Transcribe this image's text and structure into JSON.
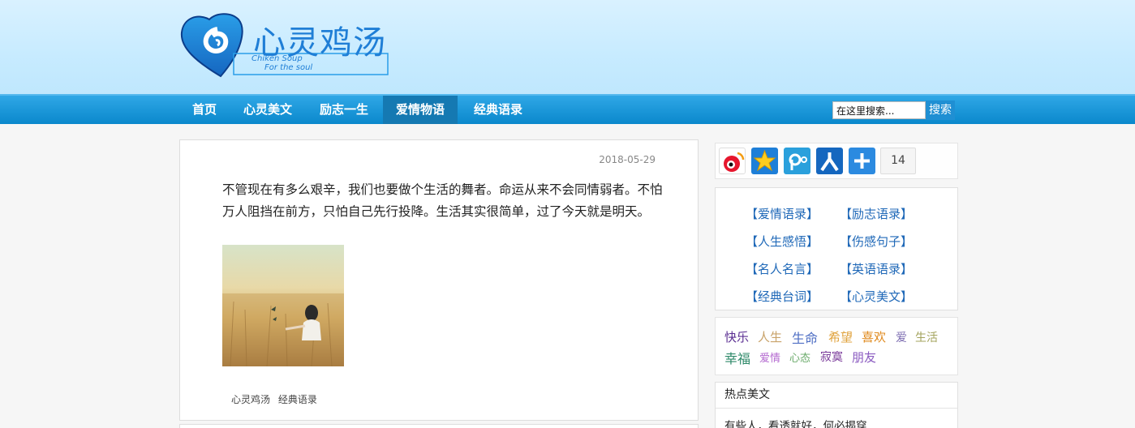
{
  "site": {
    "logo_title": "心灵鸡汤",
    "logo_subtitle_1": "Chiken Soup",
    "logo_subtitle_2": "For the soul"
  },
  "nav": {
    "items": [
      {
        "label": "首页"
      },
      {
        "label": "心灵美文"
      },
      {
        "label": "励志一生"
      },
      {
        "label": "爱情物语"
      },
      {
        "label": "经典语录"
      }
    ],
    "active": "爱情物语"
  },
  "search": {
    "value": "在这里搜索...",
    "button_label": "搜索"
  },
  "post": {
    "date": "2018-05-29",
    "text": "不管现在有多么艰辛，我们也要做个生活的舞者。命运从来不会同情弱者。不怕万人阻挡在前方，只怕自己先行投降。生活其实很简单，过了今天就是明天。",
    "tags": [
      "心灵鸡汤",
      "经典语录"
    ]
  },
  "share": {
    "icons": [
      "weibo-icon",
      "qzone-icon",
      "tencent-weibo-icon",
      "renren-icon",
      "more-share-icon"
    ],
    "count": "14"
  },
  "categories": [
    "【爱情语录】",
    "【励志语录】",
    "【人生感悟】",
    "【伤感句子】",
    "【名人名言】",
    "【英语语录】",
    "【经典台词】",
    "【心灵美文】"
  ],
  "tag_cloud": [
    {
      "label": "快乐",
      "color": "#5a2d91"
    },
    {
      "label": "人生",
      "color": "#c9a36a"
    },
    {
      "label": "生命",
      "color": "#4f6fc4"
    },
    {
      "label": "希望",
      "color": "#e0a33e"
    },
    {
      "label": "喜欢",
      "color": "#e08a1e"
    },
    {
      "label": "爱",
      "color": "#7b6bb0"
    },
    {
      "label": "生活",
      "color": "#a3a35c"
    },
    {
      "label": "幸福",
      "color": "#2f8a6a"
    },
    {
      "label": "爱情",
      "color": "#b46ad0"
    },
    {
      "label": "心态",
      "color": "#6aaa6a"
    },
    {
      "label": "寂寞",
      "color": "#7a3a9a"
    },
    {
      "label": "朋友",
      "color": "#8a5ac0"
    }
  ],
  "hot": {
    "title": "热点美文",
    "items": [
      "有些人，看透就好，何必揭穿"
    ]
  },
  "colors": {
    "nav_bg": "#0a88cc",
    "link": "#2069b8",
    "header_bg": "#c7ebff"
  }
}
